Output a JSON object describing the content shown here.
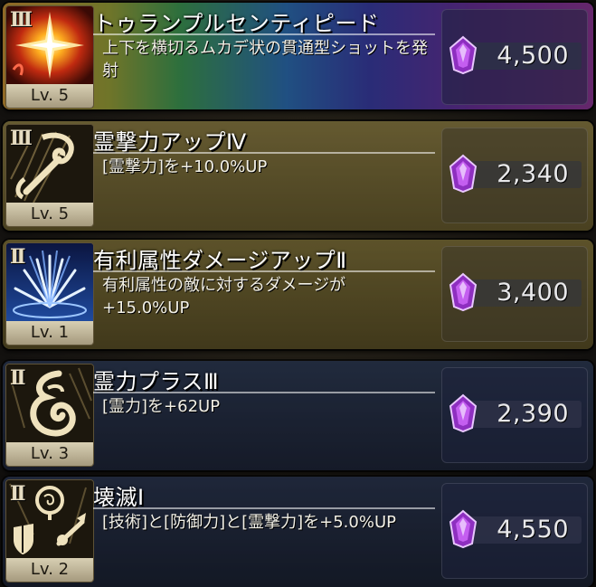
{
  "skills": [
    {
      "rank": "III",
      "level": "Lv. 5",
      "name": "トゥランプルセンティピード",
      "description": "上下を横切るムカデ状の貫通型ショットを発射",
      "price": "4,500",
      "icon": "starburst-icon"
    },
    {
      "rank": "III",
      "level": "Lv. 5",
      "name": "霊撃力アップⅣ",
      "description": "[霊撃力]を+10.0%UP",
      "price": "2,340",
      "icon": "spirit-attack-icon"
    },
    {
      "rank": "II",
      "level": "Lv. 1",
      "name": "有利属性ダメージアップⅡ",
      "description": "有利属性の敵に対するダメージが+15.0%UP",
      "price": "3,400",
      "icon": "impact-burst-icon"
    },
    {
      "rank": "II",
      "level": "Lv. 3",
      "name": "霊力プラスⅢ",
      "description": "[霊力]を+62UP",
      "price": "2,390",
      "icon": "spirit-flame-icon"
    },
    {
      "rank": "II",
      "level": "Lv. 2",
      "name": "壊滅Ⅰ",
      "description": "[技術]と[防御力]と[霊撃力]を+5.0%UP",
      "price": "4,550",
      "icon": "head-shield-sword-icon"
    }
  ],
  "currency_icon": "purple-gem-icon",
  "colors": {
    "gem": "#a63fd0",
    "icon_gold": "#e8d9b0",
    "level_plate": "#cfc5a8"
  }
}
